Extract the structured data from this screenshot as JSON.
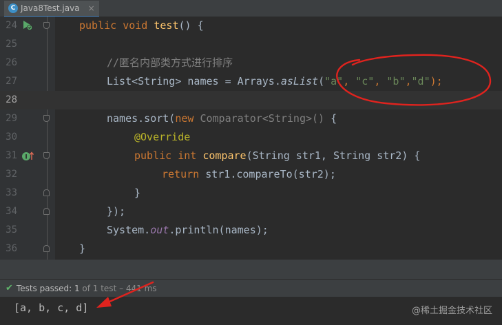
{
  "tab": {
    "title": "Java8Test.java",
    "icon": "java-class-icon",
    "close_icon": "close-icon",
    "close_glyph": "×"
  },
  "editor": {
    "lines": [
      {
        "num": "24",
        "gutter_icon": "run-test-icon"
      },
      {
        "num": "25"
      },
      {
        "num": "26",
        "comment": "//匿名内部类方式进行排序"
      },
      {
        "num": "27"
      },
      {
        "num": "28"
      },
      {
        "num": "29"
      },
      {
        "num": "30",
        "annotation": "@Override"
      },
      {
        "num": "31",
        "gutter_icon": "implements-method-icon"
      },
      {
        "num": "32"
      },
      {
        "num": "33",
        "text": "}"
      },
      {
        "num": "34",
        "text": "});"
      },
      {
        "num": "35"
      },
      {
        "num": "36",
        "text": "}"
      }
    ],
    "code": {
      "l24_kw": "public void ",
      "l24_fn": "test",
      "l24_rest": "() {",
      "l27_a": "List<String> names = Arrays.",
      "l27_method": "asList",
      "l27_open": "(",
      "l27_s1": "\"a\"",
      "l27_sep1": ", ",
      "l27_s2": "\"c\"",
      "l27_sep2": ", ",
      "l27_s3": "\"b\"",
      "l27_sep3": ",",
      "l27_s4": "\"d\"",
      "l27_close": ");",
      "l29_a": "names.sort(",
      "l29_new": "new ",
      "l29_gray": "Comparator<String>() ",
      "l29_brace": "{",
      "l31_kw": "public int ",
      "l31_fn": "compare",
      "l31_rest": "(String str1, String str2) {",
      "l32_kw": "return ",
      "l32_rest": "str1.compareTo(str2);",
      "l35_a": "System.",
      "l35_out": "out",
      "l35_rest": ".println(names);"
    }
  },
  "status": {
    "icon": "check-icon",
    "label": "Tests passed: ",
    "count": "1",
    "of_text": " of 1 test – 441 ms"
  },
  "console": {
    "output": "[a, b, c, d]",
    "watermark": "@稀土掘金技术社区"
  },
  "colors": {
    "keyword": "#cc7832",
    "string": "#6a8759",
    "annotation_red": "#e0231e"
  }
}
